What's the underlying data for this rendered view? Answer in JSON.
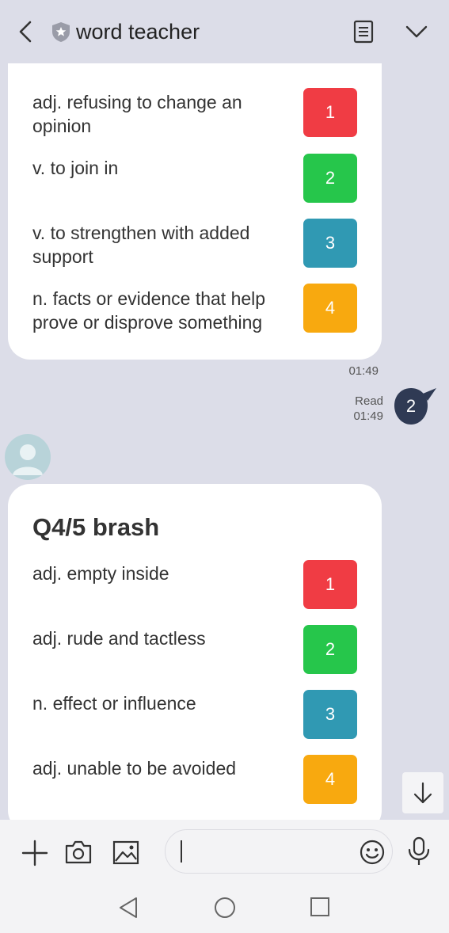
{
  "header": {
    "title": "word teacher",
    "icons": [
      "back-arrow-icon",
      "shield-star-icon",
      "notes-icon",
      "chevron-down-icon"
    ]
  },
  "colors": {
    "option1": "#f03c44",
    "option2": "#26c64b",
    "option3": "#3099b3",
    "option4": "#f8a90f",
    "my_bubble": "#2f3a54",
    "background": "#dcdde8"
  },
  "quiz_prev": {
    "options": [
      {
        "text": "adj. refusing to change an opinion",
        "num": "1"
      },
      {
        "text": "v. to join in",
        "num": "2"
      },
      {
        "text": "v. to strengthen with added support",
        "num": "3"
      },
      {
        "text": "n. facts or evidence that help prove or disprove something",
        "num": "4"
      }
    ],
    "time": "01:49"
  },
  "my_reply": {
    "read_label": "Read",
    "time": "01:49",
    "text": "2"
  },
  "quiz_current": {
    "title": "Q4/5 brash",
    "options": [
      {
        "text": "adj. empty inside",
        "num": "1"
      },
      {
        "text": "adj. rude and tactless",
        "num": "2"
      },
      {
        "text": "n. effect or influence",
        "num": "3"
      },
      {
        "text": "adj. unable to be avoided",
        "num": "4"
      }
    ]
  },
  "input": {
    "value": "",
    "icons": [
      "plus-icon",
      "camera-icon",
      "image-icon",
      "emoji-icon",
      "microphone-icon"
    ]
  },
  "navbar": {
    "icons": [
      "nav-back-icon",
      "nav-home-icon",
      "nav-recents-icon"
    ]
  }
}
